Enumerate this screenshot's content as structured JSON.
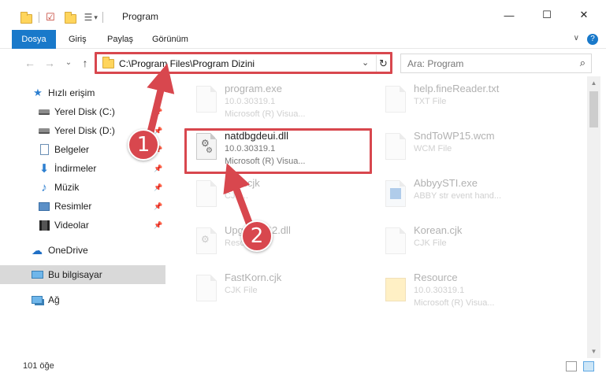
{
  "window": {
    "title": "Program",
    "minimize_glyph": "—",
    "maximize_glyph": "☐",
    "close_glyph": "✕"
  },
  "ribbon": {
    "tabs": [
      "Dosya",
      "Giriş",
      "Paylaş",
      "Görünüm"
    ],
    "help": "?",
    "chevron": "∨"
  },
  "address": {
    "path": "C:\\Program Files\\Program Dizini",
    "back": "←",
    "forward": "→",
    "recent": "⌄",
    "up": "↑",
    "dropdown": "⌄",
    "refresh": "↻"
  },
  "search": {
    "placeholder": "Ara: Program",
    "icon_glyph": "⌕"
  },
  "nav": {
    "items": [
      {
        "label": "Hızlı erişim",
        "icon": "star-icon",
        "pinned": false
      },
      {
        "label": "Yerel Disk (C:)",
        "icon": "drive-icon",
        "pinned": true
      },
      {
        "label": "Yerel Disk (D:)",
        "icon": "drive-icon",
        "pinned": true
      },
      {
        "label": "Belgeler",
        "icon": "documents-icon",
        "pinned": true
      },
      {
        "label": "İndirmeler",
        "icon": "download-icon",
        "pinned": true
      },
      {
        "label": "Müzik",
        "icon": "music-icon",
        "pinned": true
      },
      {
        "label": "Resimler",
        "icon": "pictures-icon",
        "pinned": true
      },
      {
        "label": "Videolar",
        "icon": "videos-icon",
        "pinned": true
      },
      {
        "label": "OneDrive",
        "icon": "cloud-icon",
        "pinned": false
      },
      {
        "label": "Bu bilgisayar",
        "icon": "computer-icon",
        "pinned": false
      },
      {
        "label": "Ağ",
        "icon": "network-icon",
        "pinned": false
      }
    ]
  },
  "files": [
    {
      "name": "program.exe",
      "line1": "10.0.30319.1",
      "line2": "Microsoft (R) Visua..."
    },
    {
      "name": "help.fineReader.txt",
      "line1": "TXT File",
      "line2": ""
    },
    {
      "name": "natdbgdeui.dll",
      "line1": "10.0.30319.1",
      "line2": "Microsoft (R) Visua..."
    },
    {
      "name": "SndToWP15.wcm",
      "line1": "WCM File",
      "line2": ""
    },
    {
      "name": "...an.cjk",
      "line1": "CJK...",
      "line2": ""
    },
    {
      "name": "AbbyySTI.exe",
      "line1": "ABBY str event hand...",
      "line2": ""
    },
    {
      "name": "Upg...ent42.dll",
      "line1": "Reso...LL",
      "line2": ""
    },
    {
      "name": "Korean.cjk",
      "line1": "CJK File",
      "line2": ""
    },
    {
      "name": "FastKorn.cjk",
      "line1": "CJK File",
      "line2": ""
    },
    {
      "name": "Resource",
      "line1": "10.0.30319.1",
      "line2": "Microsoft (R) Visua..."
    }
  ],
  "status": {
    "count": "101 öğe"
  },
  "annotations": {
    "step1": "1",
    "step2": "2"
  },
  "colors": {
    "accent": "#1979ca",
    "highlight": "#d8474e",
    "folder": "#ffd55c"
  }
}
